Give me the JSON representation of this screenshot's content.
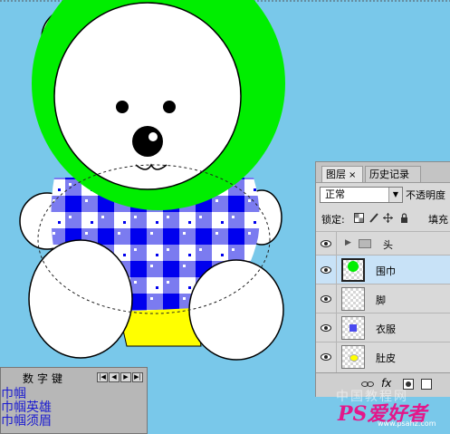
{
  "layers_panel": {
    "tabs": [
      {
        "label": "图层",
        "close": "×"
      },
      {
        "label": "历史记录"
      }
    ],
    "blend_mode": "正常",
    "opacity_label": "不透明度",
    "lock_label": "锁定:",
    "fill_label": "填充",
    "layers": [
      {
        "name": "头",
        "type": "group",
        "visible": true
      },
      {
        "name": "围巾",
        "type": "layer",
        "visible": true,
        "selected": true
      },
      {
        "name": "脚",
        "type": "layer",
        "visible": true
      },
      {
        "name": "衣服",
        "type": "layer",
        "visible": true
      },
      {
        "name": "肚皮",
        "type": "layer",
        "visible": true
      }
    ],
    "bottom_fx": "fx"
  },
  "key_panel": {
    "title": "数字键",
    "lines": [
      "巾帼",
      "巾帼英雄",
      "巾帼须眉"
    ]
  },
  "watermark": {
    "site_text": "中国教程网",
    "brand": "PS爱好者",
    "url": "www.psahz.com"
  },
  "colors": {
    "background": "#79c8ea",
    "scarf_green": "#00ee00",
    "shirt_blue": "#0000ee",
    "belly_yellow": "#ffff00",
    "selected_layer": "#c8e2f7"
  }
}
